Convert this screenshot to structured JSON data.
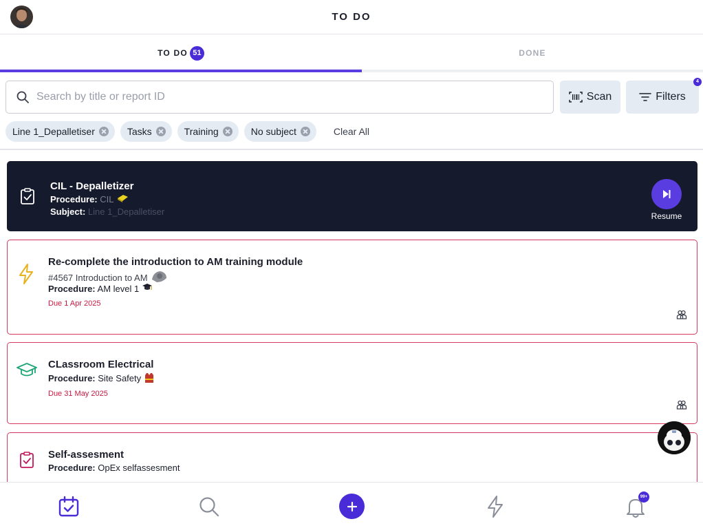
{
  "header": {
    "title": "TO DO"
  },
  "tabs": [
    {
      "label": "TO DO",
      "badge": "51",
      "active": true
    },
    {
      "label": "DONE",
      "active": false
    }
  ],
  "search": {
    "placeholder": "Search by title or report ID",
    "value": ""
  },
  "actions": {
    "scan_label": "Scan",
    "filters_label": "Filters",
    "filters_count": "4"
  },
  "chips": [
    {
      "label": "Line 1_Depalletiser"
    },
    {
      "label": "Tasks"
    },
    {
      "label": "Training"
    },
    {
      "label": "No subject"
    }
  ],
  "clear_all_label": "Clear All",
  "active_card": {
    "title": "CIL - Depalletizer",
    "procedure_label": "Procedure:",
    "procedure_value": "CIL",
    "subject_label": "Subject:",
    "subject_value": "Line 1_Depalletiser",
    "resume_label": "Resume"
  },
  "cards": [
    {
      "title": "Re-complete the introduction to AM training module",
      "reference": "#4567 Introduction to AM",
      "procedure_label": "Procedure:",
      "procedure_value": "AM level 1",
      "due": "Due 1 Apr 2025",
      "icon": "lightning-icon"
    },
    {
      "title": "CLassroom Electrical",
      "procedure_label": "Procedure:",
      "procedure_value": "Site Safety",
      "due": "Due 31 May 2025",
      "icon": "graduation-cap-icon"
    },
    {
      "title": "Self-assesment",
      "procedure_label": "Procedure:",
      "procedure_value": "OpEx selfassesment",
      "icon": "clipboard-check-icon"
    }
  ],
  "bottom_nav": {
    "notifications_badge": "99+"
  },
  "colors": {
    "accent": "#4a2bd8",
    "due": "#c8173f",
    "active_card_bg": "#161a2d",
    "chip_bg": "#e4ebf3"
  }
}
